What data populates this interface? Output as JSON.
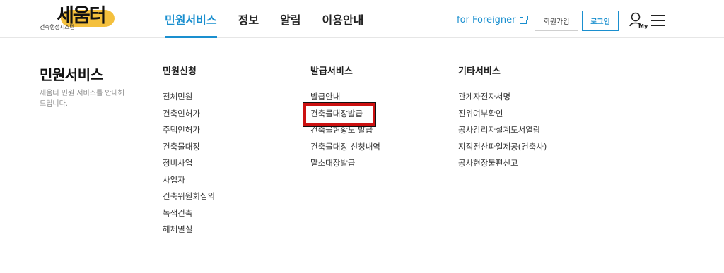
{
  "header": {
    "logo": {
      "mark": "세움터",
      "sub": "건축행정시스템"
    },
    "nav": [
      "민원서비스",
      "정보",
      "알림",
      "이용안내"
    ],
    "active_nav_index": 0,
    "foreigner_link": "for Foreigner",
    "join_label": "회원가입",
    "login_label": "로그인",
    "my_label": "My"
  },
  "menu": {
    "title": "민원서비스",
    "description": "세움터 민원 서비스를 안내해드립니다.",
    "columns": [
      {
        "title": "민원신청",
        "items": [
          "전체민원",
          "건축인허가",
          "주택인허가",
          "건축물대장",
          "정비사업",
          "사업자",
          "건축위원회심의",
          "녹색건축",
          "해체멸실"
        ]
      },
      {
        "title": "발급서비스",
        "items": [
          "발급안내",
          "건축물대장발급",
          "건축물현황도 발급",
          "건축물대장 신청내역",
          "말소대장발급"
        ]
      },
      {
        "title": "기타서비스",
        "items": [
          "관계자전자서명",
          "진위여부확인",
          "공사감리자설계도서열람",
          "지적전산파일제공(건축사)",
          "공사현장불편신고"
        ]
      }
    ],
    "highlighted_item": "건축물대장발급"
  },
  "colors": {
    "accent": "#1a8fcf",
    "highlight": "#cc1111",
    "logo_yellow": "#f2b51b"
  }
}
